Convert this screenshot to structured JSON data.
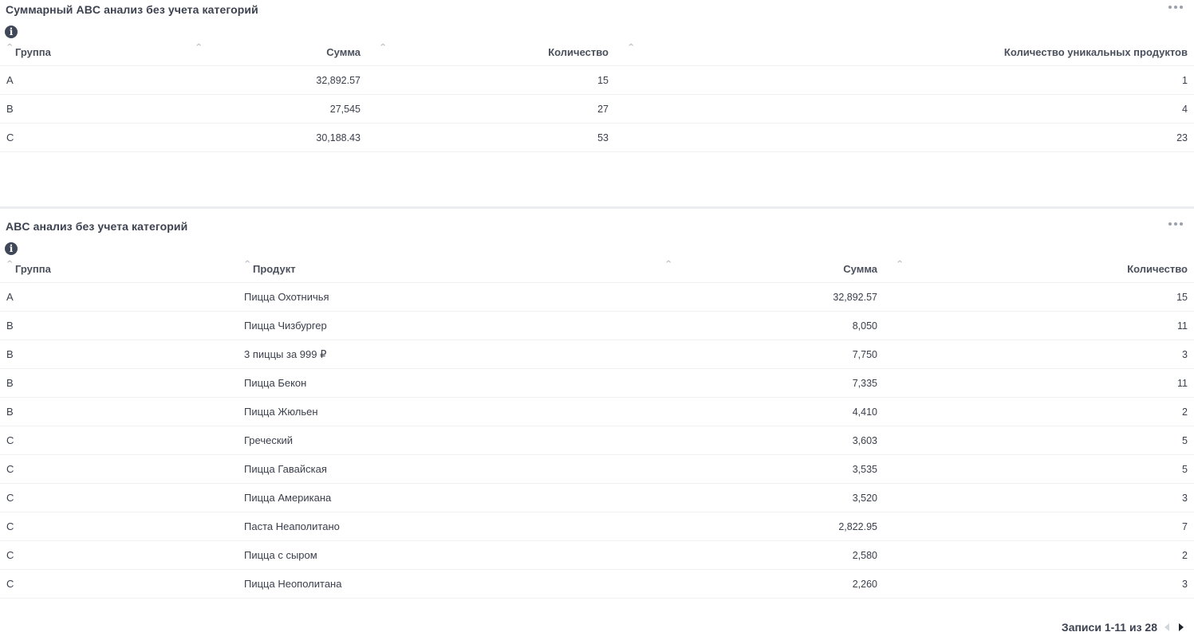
{
  "summary": {
    "title": "Суммарный ABC анализ без учета категорий",
    "info_icon": "i",
    "columns": {
      "group": "Группа",
      "sum": "Сумма",
      "count": "Количество",
      "unique": "Количество уникальных продуктов"
    },
    "rows": [
      {
        "group": "A",
        "sum": "32,892.57",
        "count": "15",
        "unique": "1"
      },
      {
        "group": "B",
        "sum": "27,545",
        "count": "27",
        "unique": "4"
      },
      {
        "group": "C",
        "sum": "30,188.43",
        "count": "53",
        "unique": "23"
      }
    ]
  },
  "detail": {
    "title": "ABC анализ без учета категорий",
    "info_icon": "i",
    "columns": {
      "group": "Группа",
      "product": "Продукт",
      "sum": "Сумма",
      "count": "Количество"
    },
    "rows": [
      {
        "group": "A",
        "product": "Пицца Охотничья",
        "sum": "32,892.57",
        "count": "15"
      },
      {
        "group": "B",
        "product": "Пицца Чизбургер",
        "sum": "8,050",
        "count": "11"
      },
      {
        "group": "B",
        "product": "3 пиццы за 999 ₽",
        "sum": "7,750",
        "count": "3"
      },
      {
        "group": "B",
        "product": "Пицца Бекон",
        "sum": "7,335",
        "count": "11"
      },
      {
        "group": "B",
        "product": "Пицца Жюльен",
        "sum": "4,410",
        "count": "2"
      },
      {
        "group": "C",
        "product": "Греческий",
        "sum": "3,603",
        "count": "5"
      },
      {
        "group": "C",
        "product": "Пицца Гавайская",
        "sum": "3,535",
        "count": "5"
      },
      {
        "group": "C",
        "product": "Пицца Американа",
        "sum": "3,520",
        "count": "3"
      },
      {
        "group": "C",
        "product": "Паста Неаполитано",
        "sum": "2,822.95",
        "count": "7"
      },
      {
        "group": "C",
        "product": "Пицца с сыром",
        "sum": "2,580",
        "count": "2"
      },
      {
        "group": "C",
        "product": "Пицца Неополитана",
        "sum": "2,260",
        "count": "3"
      }
    ],
    "pagination": {
      "label": "Записи 1-11 из 28"
    }
  },
  "icons": {
    "sort": "sort-arrow-icon",
    "more": "more-dots-icon",
    "info": "info-icon",
    "prev": "chevron-left-icon",
    "next": "chevron-right-icon"
  },
  "colors": {
    "text": "#3a3f4b",
    "info_bg": "#404759",
    "divider": "#ebedf0"
  }
}
